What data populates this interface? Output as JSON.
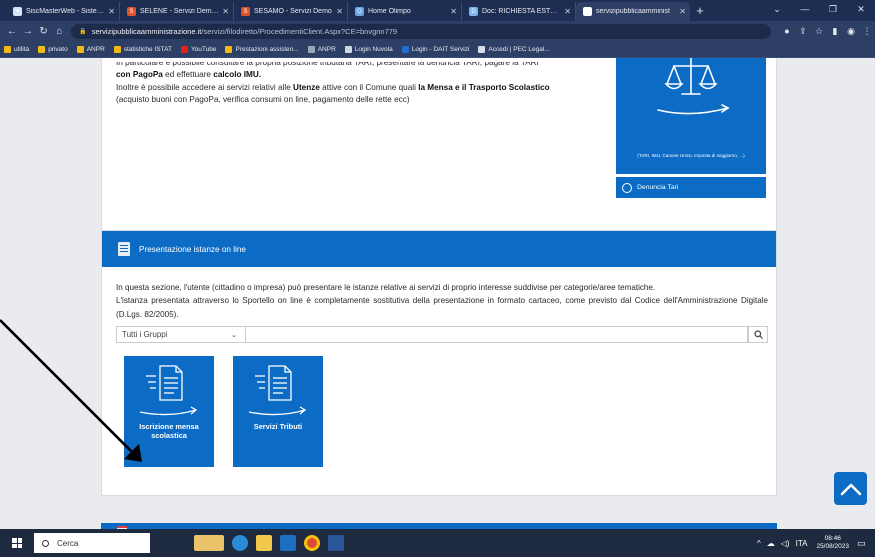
{
  "browser": {
    "tabs": [
      {
        "title": "SiscMasterWeb - Sistema",
        "fav": "#d6e4f7",
        "glyph": "✦",
        "active": false
      },
      {
        "title": "SELENE - Servizi Demog",
        "fav": "#e0532a",
        "glyph": "S",
        "active": false
      },
      {
        "title": "SESAMO - Servizi Demo",
        "fav": "#e0532a",
        "glyph": "S",
        "active": false
      },
      {
        "title": "Home Olimpo",
        "fav": "#6aa5e6",
        "glyph": "O",
        "active": false
      },
      {
        "title": "Doc: RICHIESTA ESTRAT",
        "fav": "#7cb3ea",
        "glyph": "D",
        "active": false
      },
      {
        "title": "servizipubblicaamminist",
        "fav": "#ffffff",
        "glyph": "",
        "active": true
      }
    ],
    "new_tab_label": "+",
    "url_host": "servizipubblicaamministrazione.it",
    "url_path": "/servizi/filodiretto/ProcedimentiClient.Aspx?CE=bnvgnn779",
    "bookmarks": [
      {
        "label": "utilità",
        "color": "#f2b90f"
      },
      {
        "label": "privato",
        "color": "#f2b90f"
      },
      {
        "label": "ANPR",
        "color": "#f2b90f"
      },
      {
        "label": "statistiche ISTAT",
        "color": "#f2b90f"
      },
      {
        "label": "YouTube",
        "color": "#e62117"
      },
      {
        "label": "Prestazioni assisten...",
        "color": "#f2b90f"
      },
      {
        "label": "ANPR",
        "color": "#9aa6bb"
      },
      {
        "label": "Login Nuvola",
        "color": "#cfd6e4"
      },
      {
        "label": "Login - DAIT Servizi",
        "color": "#1f6fd1"
      },
      {
        "label": "Accedi | PEC Legal...",
        "color": "#d6dce8"
      }
    ]
  },
  "top_section": {
    "partial_line": "In particolare è possibile consultare la propria posizione tributaria TARI, presentare la denuncia TARI, pagare la TARI",
    "line2_a": "con PagoPa",
    "line2_b": " ed effettuare ",
    "line2_c": "calcolo IMU.",
    "line3_a": "Inoltre è possibile accedere ai servizi relativi alle ",
    "line3_b": "Utenze",
    "line3_c": " attive con il Comune quali ",
    "line3_d": "la Mensa e il Trasporto Scolastico",
    "line4": "(acquisto buoni con PagoPa, verifica consumi on line, pagamento delle rette ecc)",
    "tile_caption": "(TARI, IMU, Canone Unico, Imposta di soggiorno, ...)",
    "tile_strip_label": "Denuncia Tari"
  },
  "istanze_section": {
    "header": "Presentazione istanze on line",
    "desc1": "In questa sezione, l'utente (cittadino o impresa) può presentare le istanze relative ai servizi di proprio interesse suddivise per categorie/aree tematiche.",
    "desc2": "L'istanza presentata attraverso lo Sportello on line è completamente sostitutiva della presentazione in formato cartaceo, come previsto dal Codice dell'Amministrazione Digitale (D.Lgs. 82/2005).",
    "group_select_value": "Tutti i Gruppi",
    "services": [
      {
        "label": "Iscrizione mensa scolastica"
      },
      {
        "label": "Servizi Tributi"
      }
    ]
  },
  "taskbar": {
    "search_label": "Cerca",
    "lang": "ITA",
    "time": "08:46",
    "date": "25/08/2023"
  },
  "colors": {
    "brand_blue": "#0b6bc5",
    "chrome_dark": "#1e2d52"
  }
}
